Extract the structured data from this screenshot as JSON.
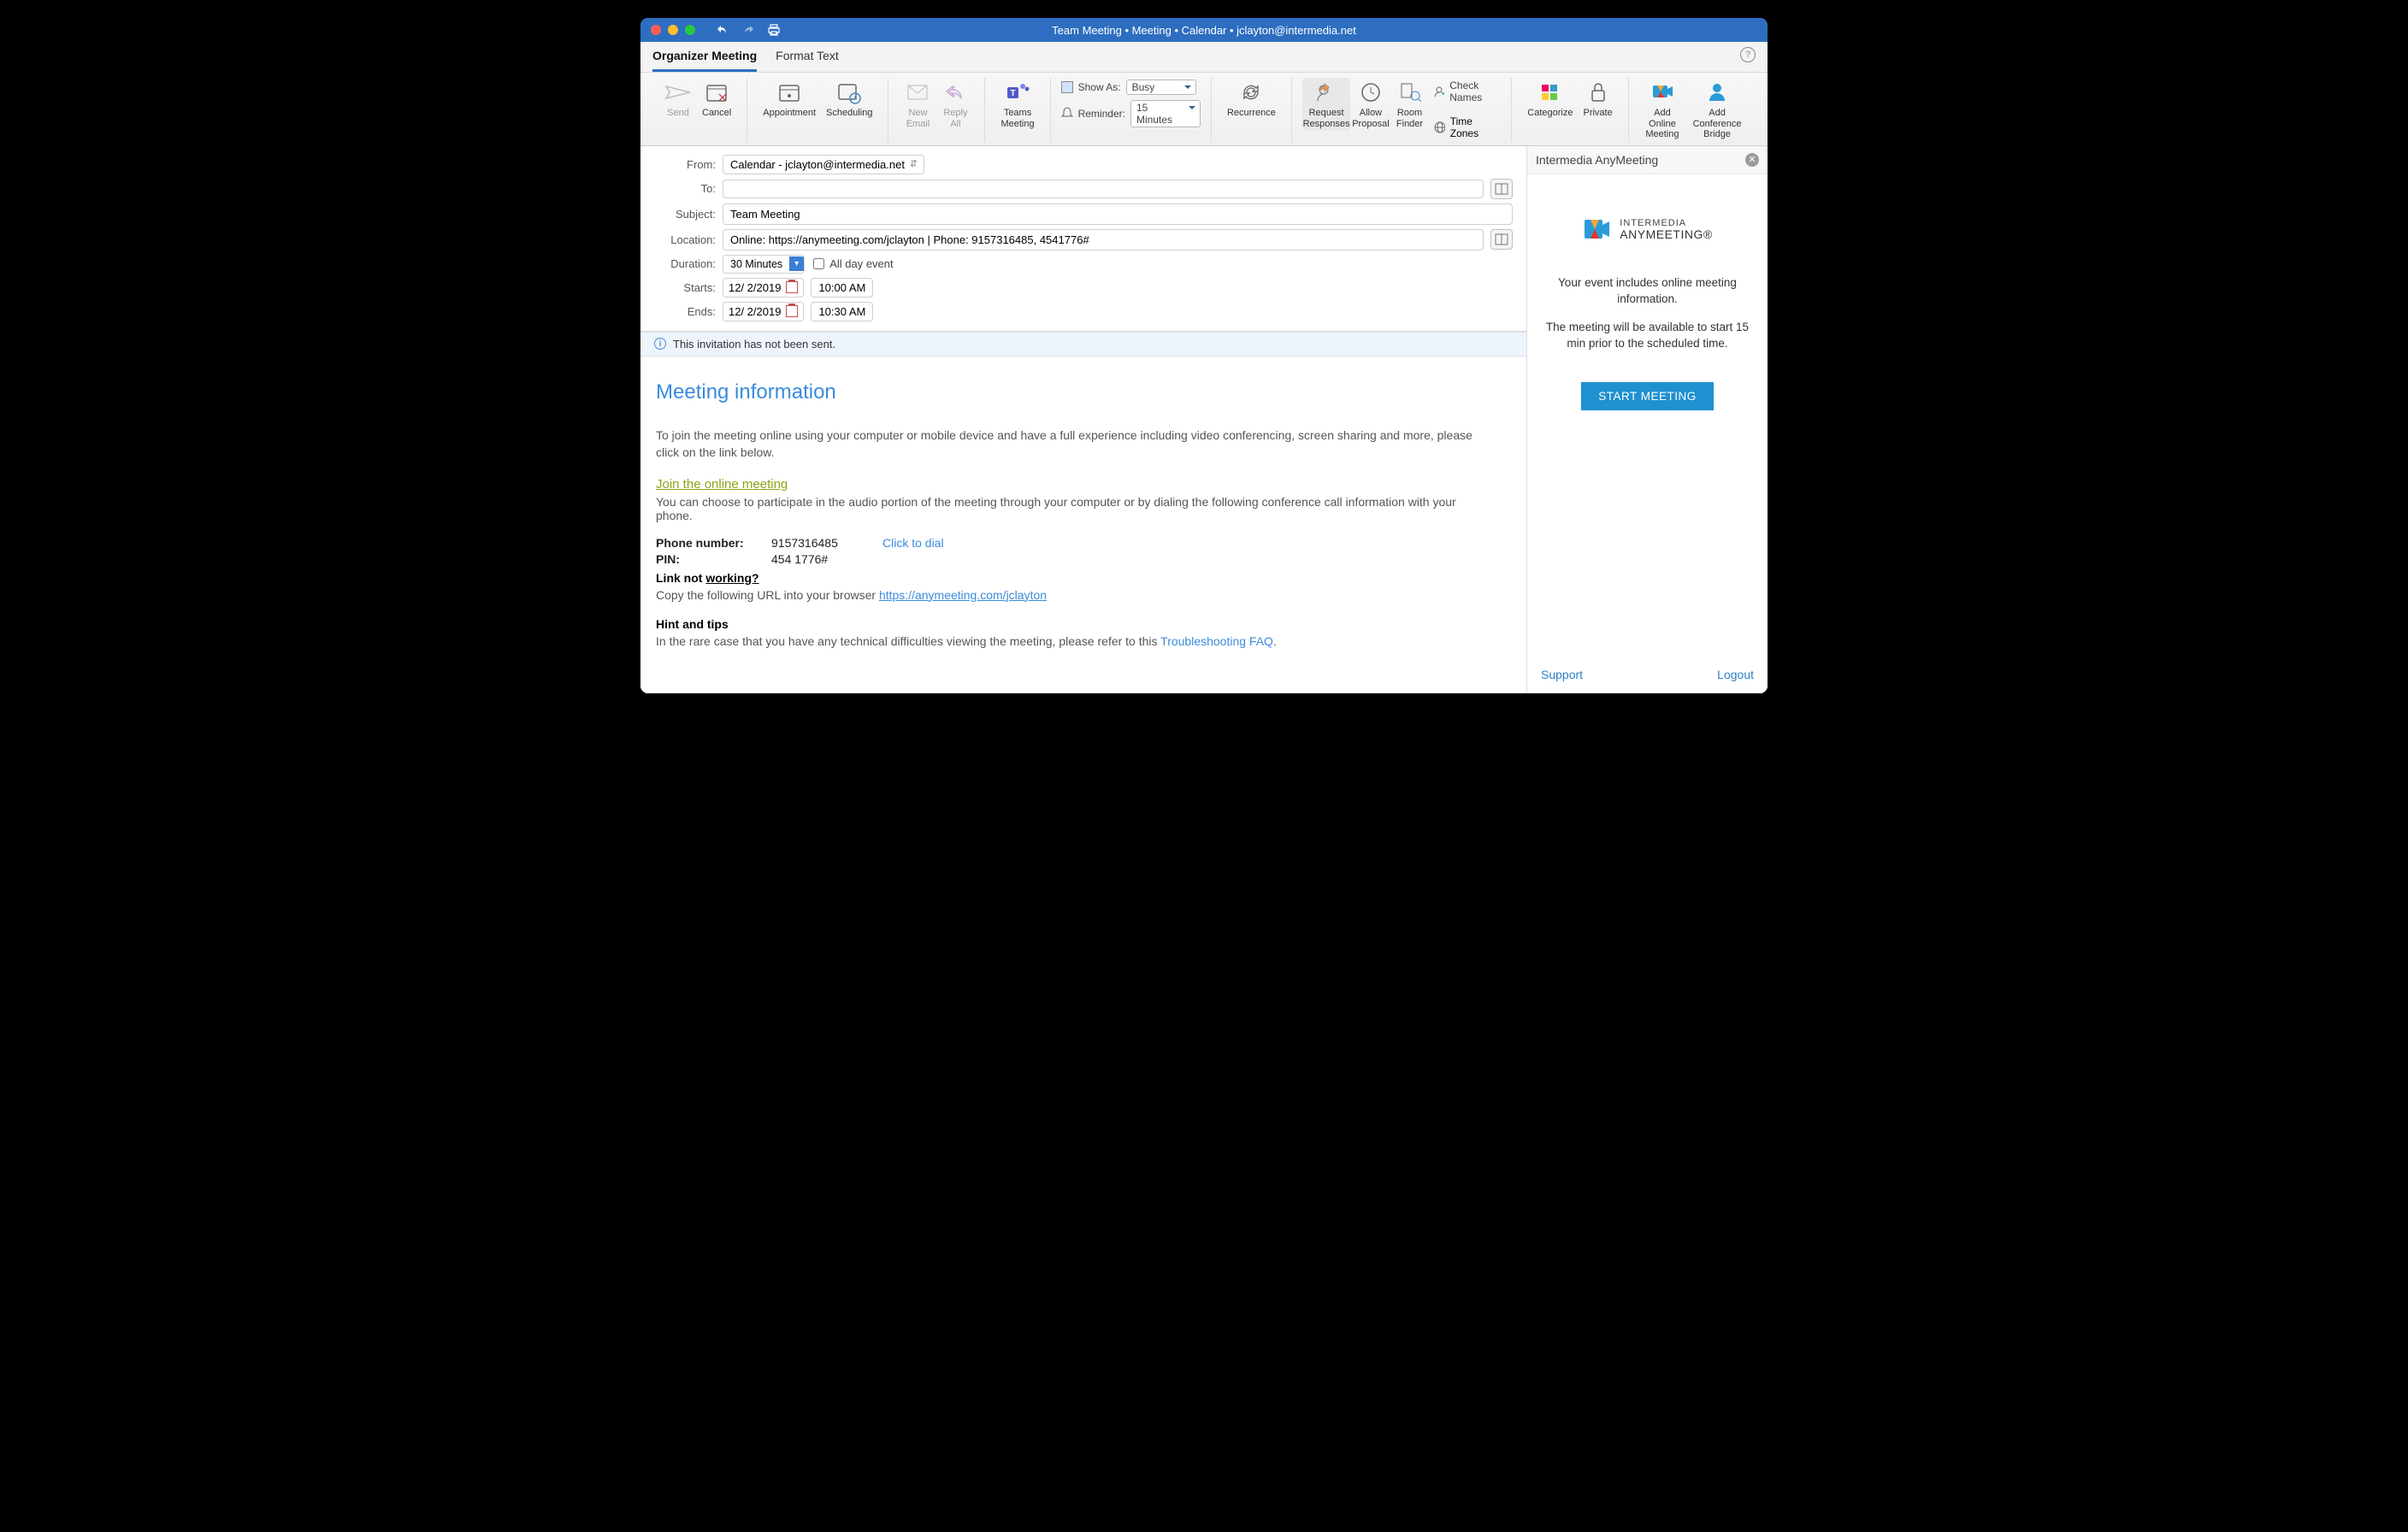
{
  "titlebar": {
    "title": "Team Meeting • Meeting • Calendar • jclayton@intermedia.net"
  },
  "tabs": {
    "organizer": "Organizer Meeting",
    "format": "Format Text"
  },
  "ribbon": {
    "send": "Send",
    "cancel": "Cancel",
    "appointment": "Appointment",
    "scheduling": "Scheduling",
    "new_email": "New\nEmail",
    "reply_all": "Reply\nAll",
    "teams": "Teams\nMeeting",
    "show_as_label": "Show As:",
    "show_as_value": "Busy",
    "reminder_label": "Reminder:",
    "reminder_value": "15 Minutes",
    "recurrence": "Recurrence",
    "request_responses": "Request\nResponses",
    "allow_proposal": "Allow\nProposal",
    "room_finder": "Room\nFinder",
    "check_names": "Check Names",
    "time_zones": "Time Zones",
    "categorize": "Categorize",
    "private": "Private",
    "add_online": "Add Online\nMeeting",
    "add_conf": "Add Conference\nBridge"
  },
  "form": {
    "from_label": "From:",
    "from_value": "Calendar - jclayton@intermedia.net",
    "to_label": "To:",
    "to_value": "",
    "subject_label": "Subject:",
    "subject_value": "Team Meeting",
    "location_label": "Location:",
    "location_value": "Online: https://anymeeting.com/jclayton | Phone: 9157316485, 4541776#",
    "duration_label": "Duration:",
    "duration_value": "30 Minutes",
    "allday_label": "All day event",
    "starts_label": "Starts:",
    "starts_date": "12/  2/2019",
    "starts_time": "10:00 AM",
    "ends_label": "Ends:",
    "ends_date": "12/  2/2019",
    "ends_time": "10:30 AM"
  },
  "notice": "This invitation has not been sent.",
  "body": {
    "heading": "Meeting information",
    "intro": "To join the meeting online using your computer or mobile device and have a full experience including video conferencing, screen sharing and more, please click on the link below.",
    "join_link": "Join the online meeting",
    "audio_note": "You can choose to participate in the audio portion of the meeting through your computer or by dialing the following conference call information with your phone.",
    "phone_label": "Phone number:",
    "phone_value": "9157316485",
    "click_to_dial": "Click to dial",
    "pin_label": "PIN:",
    "pin_value": "454 1776#",
    "link_not_prefix": "Link not ",
    "link_not_working": "working?",
    "copy_text": "Copy the following URL into your browser ",
    "copy_url": "https://anymeeting.com/jclayton",
    "hints_title": "Hint and tips",
    "hints_text_pre": "In the rare case that you have any technical difficulties viewing the meeting, please refer to this ",
    "hints_link": "Troubleshooting FAQ",
    "hints_text_post": "."
  },
  "side": {
    "title": "Intermedia AnyMeeting",
    "brand_top": "INTERMEDIA",
    "brand_bottom": "ANYMEETING®",
    "msg1": "Your event includes online meeting information.",
    "msg2": "The meeting will be available to start 15 min prior to the scheduled time.",
    "start": "START MEETING",
    "support": "Support",
    "logout": "Logout"
  }
}
